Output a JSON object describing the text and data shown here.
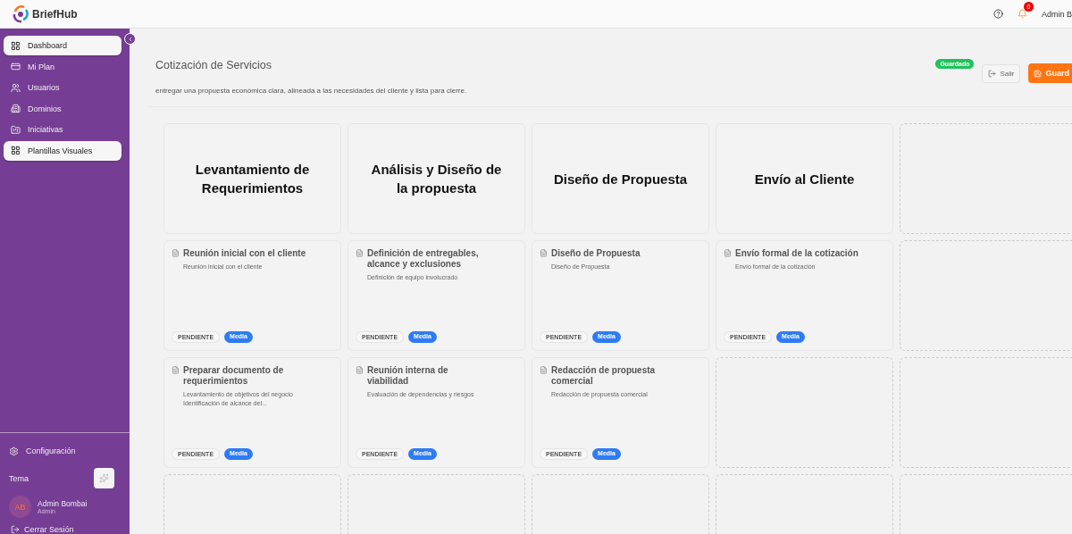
{
  "header": {
    "brand": "BriefHub",
    "notifications": "0",
    "user": "Admin B"
  },
  "sidebar": {
    "items": [
      {
        "label": "Dashboard",
        "selected": true
      },
      {
        "label": "Mi Plan",
        "selected": false
      },
      {
        "label": "Usuarios",
        "selected": false
      },
      {
        "label": "Dominios",
        "selected": false
      },
      {
        "label": "Iniciativas",
        "selected": false
      },
      {
        "label": "Plantillas Visuales",
        "selected": true
      }
    ],
    "settings": "Configuración",
    "theme_label": "Tema",
    "profile": {
      "initials": "AB",
      "name": "Admin Bombai",
      "role": "Admin"
    },
    "logout": "Cerrar Sesión"
  },
  "page": {
    "title": "Cotización de Servicios",
    "description": "entregar una propuesta económica clara, alineada a las necesidades del cliente y lista para cierre.",
    "status_badge": "Guardado",
    "exit_button": "Salir",
    "save_button": "Guard"
  },
  "board": {
    "rows": [
      [
        {
          "kind": "stage",
          "title": "Levantamiento de Requerimientos"
        },
        {
          "kind": "stage",
          "title": "Análisis y Diseño de la propuesta"
        },
        {
          "kind": "stage",
          "title": "Diseño de Propuesta"
        },
        {
          "kind": "stage",
          "title": "Envío al Cliente"
        },
        {
          "kind": "empty"
        }
      ],
      [
        {
          "kind": "task",
          "title": "Reunión inicial con el cliente",
          "description": "Reunión inicial con el cliente",
          "status": "PENDIENTE",
          "priority": "Media"
        },
        {
          "kind": "task",
          "title": "Definición de entregables, alcance y exclusiones",
          "description": "Definición de equipo involucrado",
          "status": "PENDIENTE",
          "priority": "Media"
        },
        {
          "kind": "task",
          "title": "Diseño de Propuesta",
          "description": "Diseño de Propuesta",
          "status": "PENDIENTE",
          "priority": "Media"
        },
        {
          "kind": "task",
          "title": "Envío formal de la cotización",
          "description": "Envío formal de la cotización",
          "status": "PENDIENTE",
          "priority": "Media"
        },
        {
          "kind": "empty"
        }
      ],
      [
        {
          "kind": "task",
          "title": "Preparar documento de requerimientos",
          "description": "Levantamiento de objetivos del negocio Identificación de alcance del...",
          "status": "PENDIENTE",
          "priority": "Media"
        },
        {
          "kind": "task",
          "title": "Reunión interna de viabilidad",
          "description": "Evaluación de dependencias y riesgos",
          "status": "PENDIENTE",
          "priority": "Media"
        },
        {
          "kind": "task",
          "title": "Redacción de propuesta comercial",
          "description": "Redacción de propuesta comercial",
          "status": "PENDIENTE",
          "priority": "Media"
        },
        {
          "kind": "empty"
        },
        {
          "kind": "empty"
        }
      ],
      [
        {
          "kind": "empty"
        },
        {
          "kind": "empty"
        },
        {
          "kind": "empty"
        },
        {
          "kind": "empty"
        },
        {
          "kind": "empty"
        }
      ]
    ]
  }
}
